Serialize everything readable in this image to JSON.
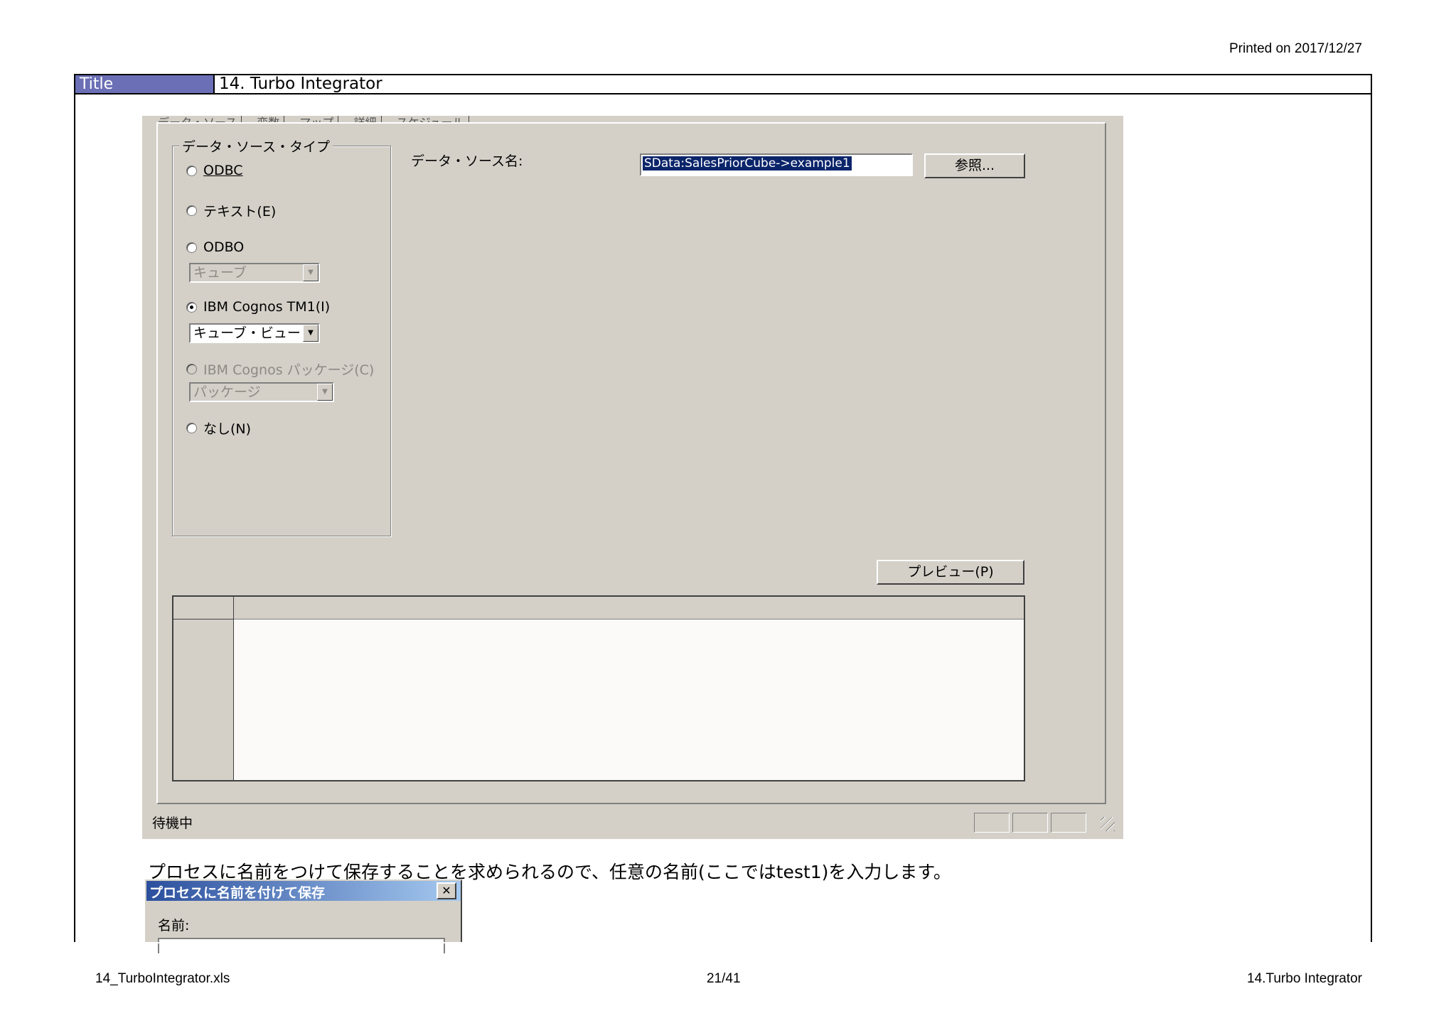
{
  "header": {
    "print_date": "Printed on 2017/12/27"
  },
  "title_bar": {
    "label": "Title",
    "value": "14. Turbo Integrator"
  },
  "dialog_window": {
    "tabs": [
      "データ・ソース",
      "変数",
      "マップ",
      "詳細",
      "スケジュール"
    ],
    "group": {
      "legend": "データ・ソース・タイプ",
      "options": [
        {
          "label": "ODBC",
          "checked": false,
          "disabled": false
        },
        {
          "label": "テキスト(E)",
          "checked": false,
          "disabled": false
        },
        {
          "label": "ODBO",
          "checked": false,
          "disabled": false
        },
        {
          "label": "IBM Cognos TM1(I)",
          "checked": true,
          "disabled": false
        },
        {
          "label": "IBM Cognos パッケージ(C)",
          "checked": false,
          "disabled": true
        },
        {
          "label": "なし(N)",
          "checked": false,
          "disabled": false
        }
      ],
      "combo_odbo": "キューブ",
      "combo_tm1": "キューブ・ビュー",
      "combo_package": "パッケージ"
    },
    "datasource_label": "データ・ソース名:",
    "datasource_value": "SData:SalesPriorCube->example1",
    "browse_button": "参照...",
    "preview_button": "プレビュー(P)",
    "status_text": "待機中"
  },
  "instruction": "プロセスに名前をつけて保存することを求められるので、任意の名前(ここではtest1)を入力します。",
  "save_dialog": {
    "title": "プロセスに名前を付けて保存",
    "close": "✕",
    "name_label": "名前:"
  },
  "footer": {
    "left": "14_TurboIntegrator.xls",
    "center": "21/41",
    "right": "14.Turbo Integrator"
  }
}
